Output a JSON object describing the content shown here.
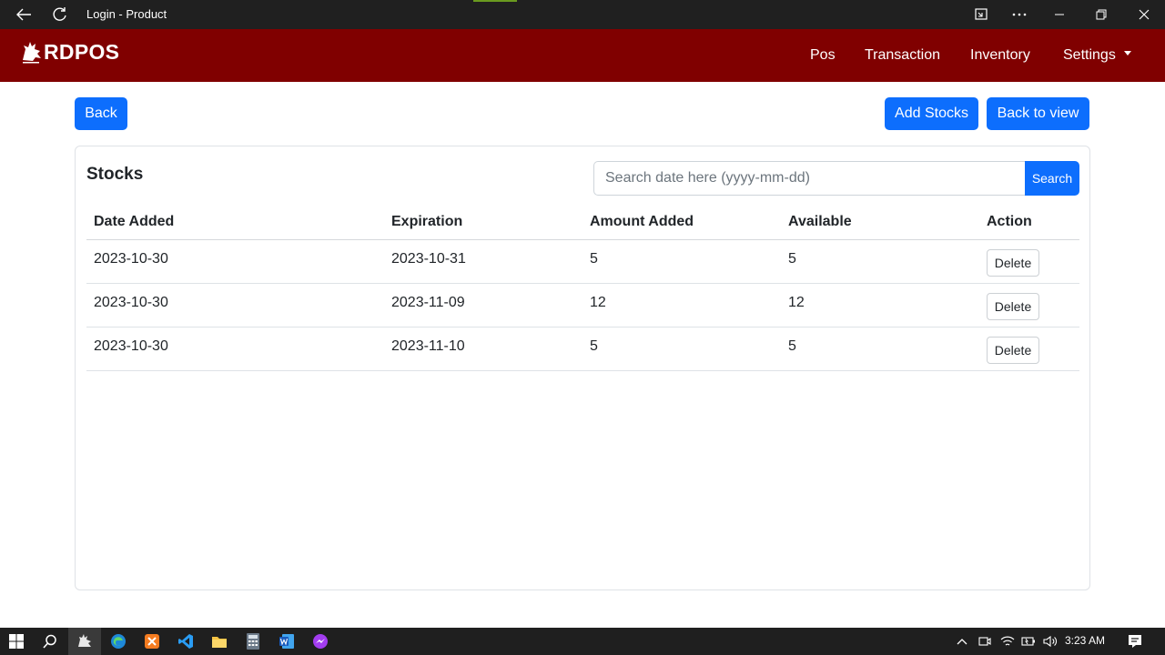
{
  "window": {
    "title": "Login - Product"
  },
  "navbar": {
    "brand": "RDPOS",
    "items": [
      {
        "label": "Pos"
      },
      {
        "label": "Transaction"
      },
      {
        "label": "Inventory"
      },
      {
        "label": "Settings",
        "dropdown": true
      }
    ]
  },
  "toolbar": {
    "back_label": "Back",
    "add_stocks_label": "Add Stocks",
    "back_to_view_label": "Back to view"
  },
  "stocks": {
    "title": "Stocks",
    "search_placeholder": "Search date here (yyyy-mm-dd)",
    "search_value": "",
    "search_button": "Search",
    "columns": [
      "Date Added",
      "Expiration",
      "Amount Added",
      "Available",
      "Action"
    ],
    "rows": [
      {
        "date_added": "2023-10-30",
        "expiration": "2023-10-31",
        "amount_added": "5",
        "available": "5",
        "action": "Delete"
      },
      {
        "date_added": "2023-10-30",
        "expiration": "2023-11-09",
        "amount_added": "12",
        "available": "12",
        "action": "Delete"
      },
      {
        "date_added": "2023-10-30",
        "expiration": "2023-11-10",
        "amount_added": "5",
        "available": "5",
        "action": "Delete"
      }
    ]
  },
  "taskbar": {
    "clock": "3:23 AM"
  },
  "colors": {
    "navbar": "#800000",
    "primary": "#0d6efd",
    "titlebar": "#202020",
    "taskbar": "#1f1f1f"
  }
}
